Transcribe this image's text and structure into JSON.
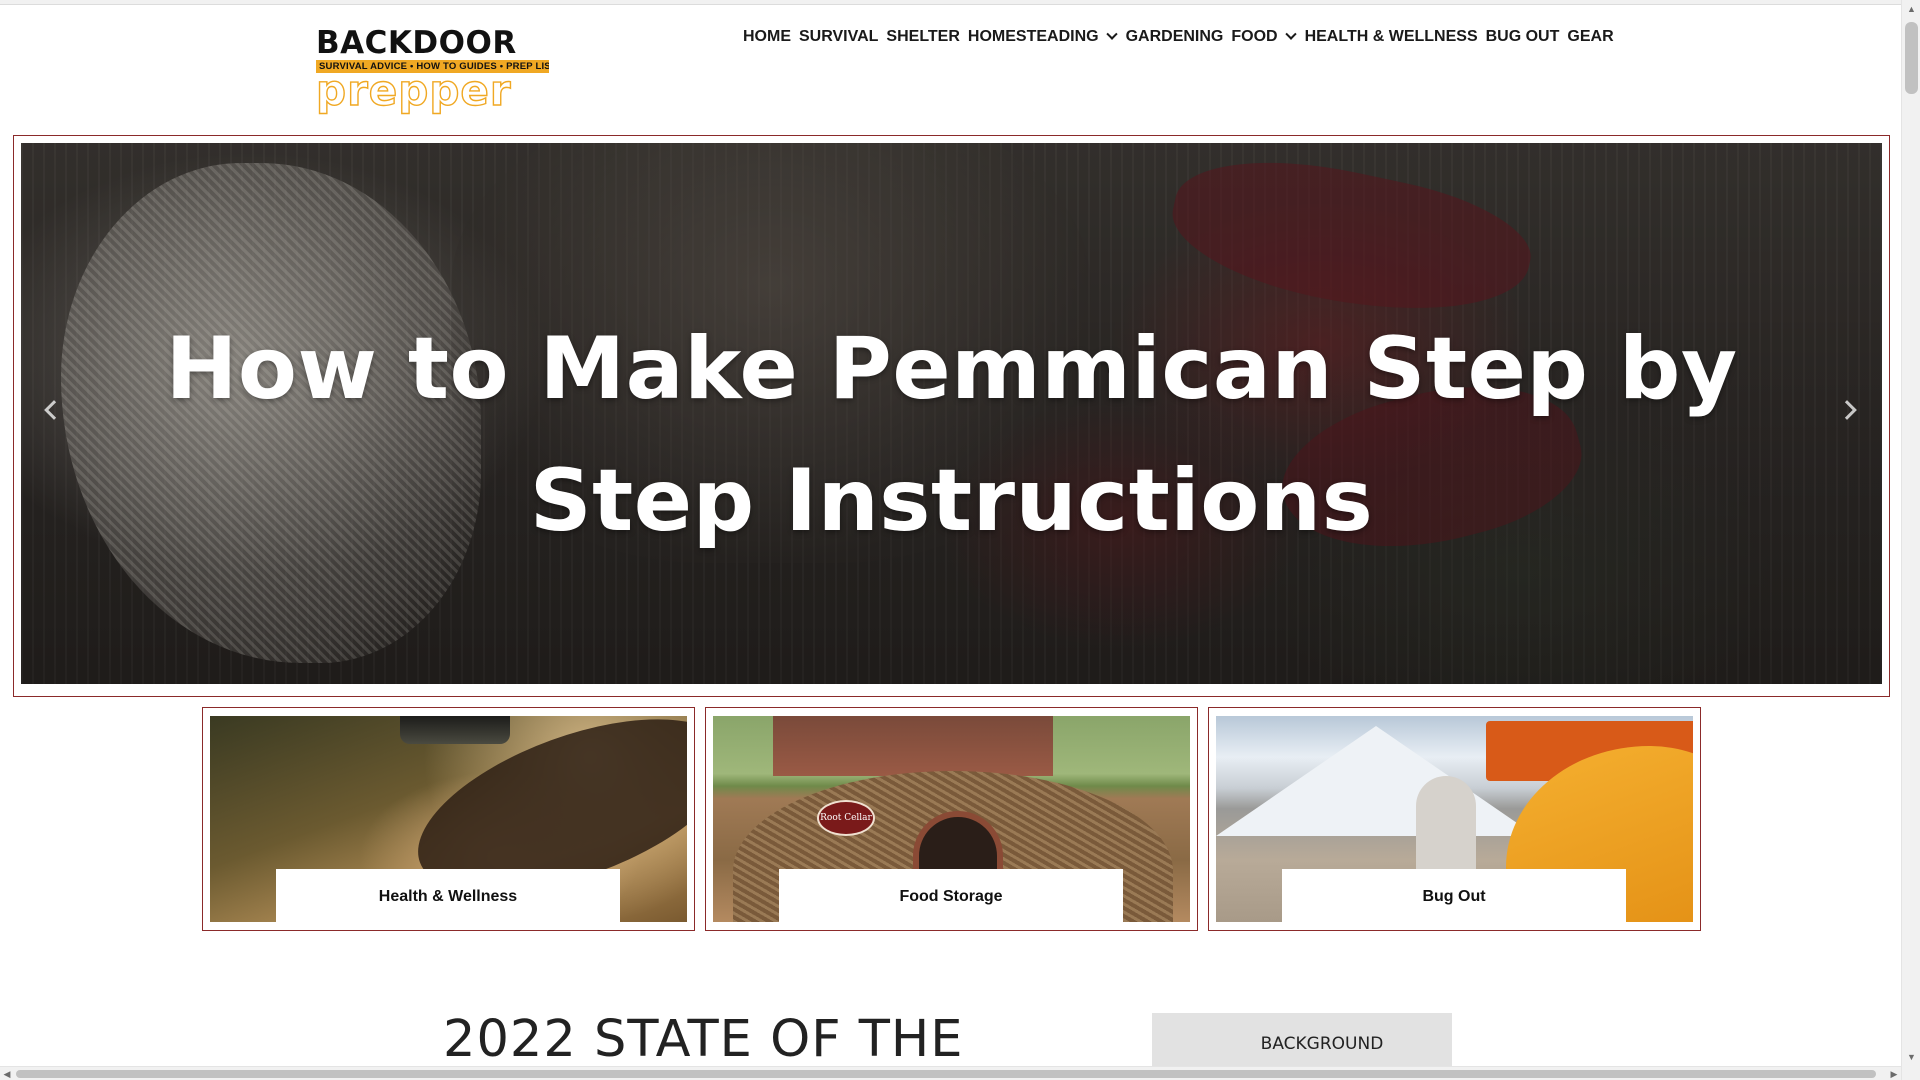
{
  "logo": {
    "top": "BACKDOOR",
    "strip": "SURVIVAL ADVICE • HOW TO GUIDES • PREP LISTS",
    "bottom": "prepper"
  },
  "nav": {
    "items": [
      {
        "label": "HOME",
        "dropdown": false
      },
      {
        "label": "SURVIVAL",
        "dropdown": false
      },
      {
        "label": "SHELTER",
        "dropdown": false
      },
      {
        "label": "HOMESTEADING",
        "dropdown": true
      },
      {
        "label": "GARDENING",
        "dropdown": false
      },
      {
        "label": "FOOD",
        "dropdown": true
      },
      {
        "label": "HEALTH & WELLNESS",
        "dropdown": false
      },
      {
        "label": "BUG OUT",
        "dropdown": false
      },
      {
        "label": "GEAR",
        "dropdown": false
      }
    ]
  },
  "hero": {
    "title_line1": "How to Make Pemmican Step by",
    "title_line2": "Step Instructions"
  },
  "cards": [
    {
      "label": "Health & Wellness"
    },
    {
      "label": "Food Storage",
      "sign_text": "Root Cellar"
    },
    {
      "label": "Bug Out"
    }
  ],
  "section": {
    "title": "2022 STATE OF THE",
    "tab_label": "BACKGROUND"
  },
  "colors": {
    "accent": "#f0a823",
    "card_border": "#8b2a2a"
  },
  "icons": {
    "hero_prev": "chevron-left-icon",
    "hero_next": "chevron-right-icon",
    "nav_dropdown": "chevron-down-icon"
  }
}
